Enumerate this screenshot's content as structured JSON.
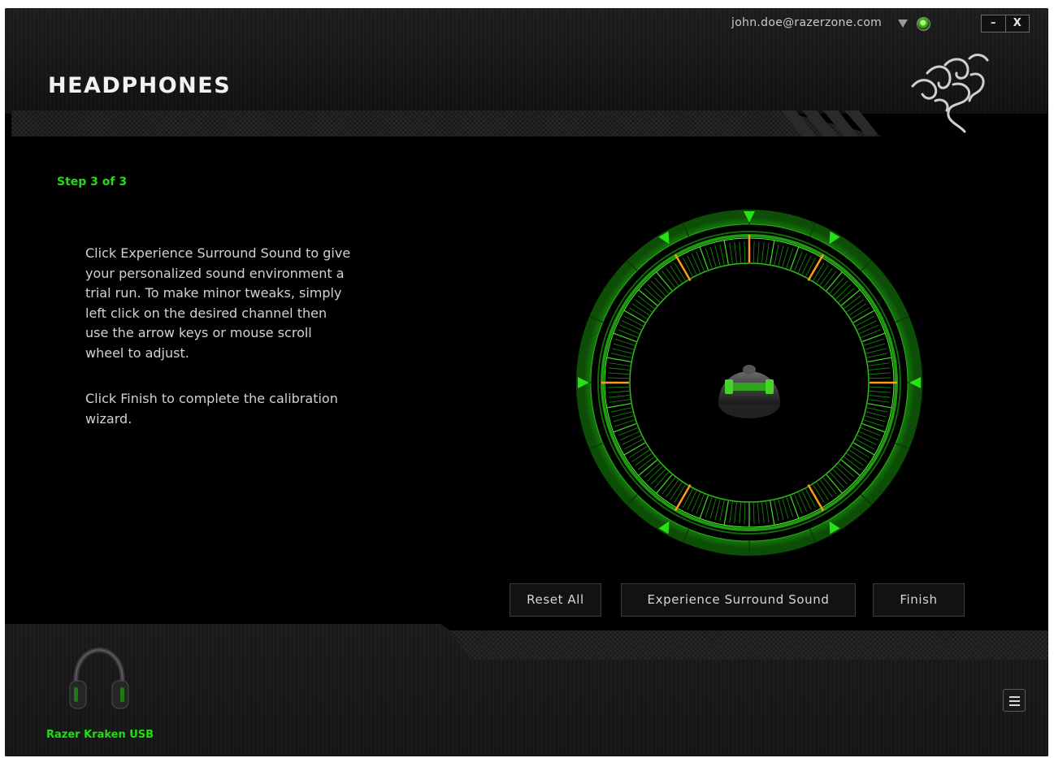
{
  "window": {
    "title": "HEADPHONES",
    "account_email": "john.doe@razerzone.com",
    "minimize_label": "–",
    "close_label": "X"
  },
  "wizard": {
    "step": "Step 3 of 3",
    "instructions": [
      "Click Experience Surround Sound to give your personalized sound environment a trial run. To make minor tweaks, simply left click on the desired channel then use the arrow keys or mouse scroll wheel to adjust.",
      "Click Finish to complete the calibration wizard."
    ],
    "channels": 7
  },
  "buttons": {
    "reset_all": "Reset All",
    "experience": "Experience Surround Sound",
    "finish": "Finish"
  },
  "device": {
    "name": "Razer Kraken USB"
  },
  "colors": {
    "accent_green": "#22dd11",
    "channel_marker": "#ff9a1a",
    "background": "#000000"
  }
}
